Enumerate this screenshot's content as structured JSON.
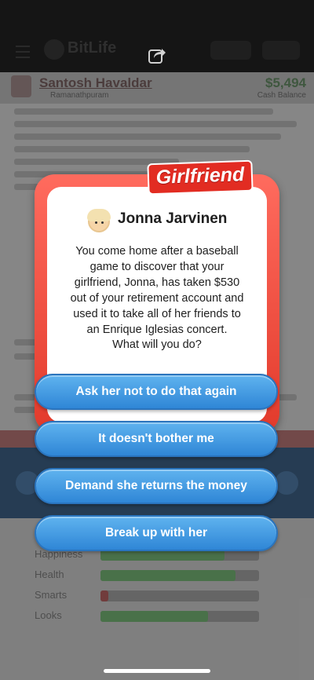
{
  "background": {
    "app_logo": "BitLife",
    "profile_name": "Santosh Havaldar",
    "profile_subtitle": "Ramanathpuram",
    "money": "$5,494",
    "money_caption": "Cash Balance",
    "stats_labels": [
      "Happiness",
      "Health",
      "Smarts",
      "Looks"
    ],
    "stats_values": [
      0.78,
      0.85,
      0.05,
      0.68
    ]
  },
  "modal": {
    "category_title": "Girlfriend",
    "person_icon": "blonde-woman-emoji",
    "person_name": "Jonna Jarvinen",
    "message": "You come home after a baseball game to discover that your girlfriend, Jonna, has taken $530 out of your retirement account and used it to take all of her friends to an Enrique Iglesias concert.",
    "question": "What will you do?",
    "choices": [
      "Ask her not to do that again",
      "It doesn't bother me",
      "Demand she returns the money",
      "Break up with her"
    ]
  },
  "colors": {
    "modal_frame": "#e23a2b",
    "choice_button": "#3a93e0",
    "text": "#1e1e1e"
  }
}
